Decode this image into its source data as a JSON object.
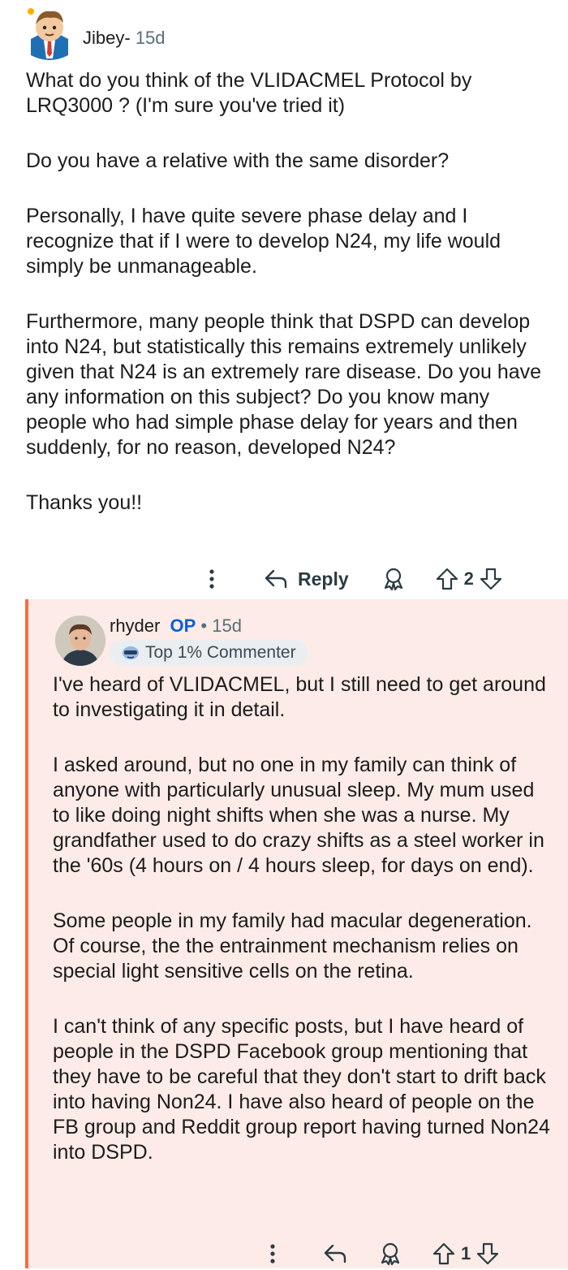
{
  "comment1": {
    "author": "Jibey-",
    "age": "15d",
    "paragraphs": [
      "What do you think of the VLIDACMEL Protocol by LRQ3000 ? (I'm sure you've tried it)",
      "Do you have a relative with the same disorder?",
      "Personally, I have quite severe phase delay and I recognize that if I were to develop N24, my life would simply be unmanageable.",
      "Furthermore, many people think that DSPD can develop into N24, but statistically this remains extremely unlikely given that N24 is an extremely rare disease. Do you have any information on this subject? Do you know many people who had simple phase delay for years and then suddenly, for no reason, developed N24?",
      "Thanks you!!"
    ],
    "reply_label": "Reply",
    "score": "2",
    "icons": [
      "more-vertical-icon",
      "reply-arrow-icon",
      "award-icon",
      "upvote-icon",
      "downvote-icon"
    ]
  },
  "comment2": {
    "author": "rhyder",
    "op_badge": "OP",
    "separator": "•",
    "age": "15d",
    "flair": "Top 1% Commenter",
    "paragraphs": [
      "I've heard of VLIDACMEL, but I still need to get around to investigating it in detail.",
      "I asked around, but no one in my family can think of anyone with particularly unusual sleep. My mum used to like doing night shifts when she was a nurse. My grandfather used to do crazy shifts as a steel worker in the '60s (4 hours on / 4 hours sleep, for days on end).",
      "Some people in my family had macular degeneration. Of course, the the entrainment mechanism relies on special light sensitive cells on the retina.",
      "I can't think of any specific posts, but I have heard of people in the DSPD Facebook group mentioning that they have to be careful that they don't start to drift back into having Non24. I have also heard of people on the FB group and Reddit group report having turned Non24 into DSPD."
    ],
    "score": "1"
  },
  "colors": {
    "thread_line": "#ff6a3d",
    "op_badge": "#0a5fd8",
    "highlight_bg": "#fcebe6"
  }
}
